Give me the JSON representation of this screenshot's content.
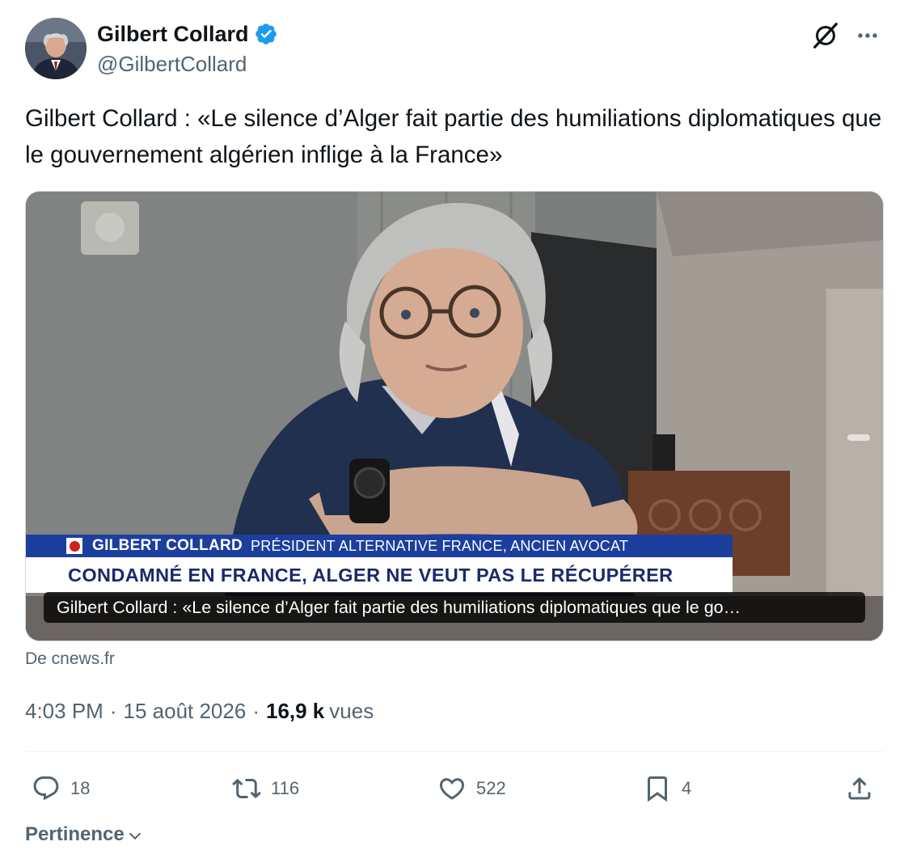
{
  "author": {
    "display_name": "Gilbert Collard",
    "handle": "@GilbertCollard",
    "verified": true,
    "verified_color": "#1d9bf0"
  },
  "header_icons": [
    "grok-icon",
    "more-icon"
  ],
  "tweet": {
    "text": "Gilbert Collard : «Le silence d’Alger fait partie des humiliations diplomatiques que le gouvernement algérien inflige à la France»"
  },
  "media": {
    "lower_third": {
      "name": "GILBERT COLLARD",
      "role": "PRÉSIDENT ALTERNATIVE FRANCE, ANCIEN AVOCAT",
      "headline": "CONDAMNÉ EN FRANCE, ALGER NE VEUT PAS LE RÉCUPÉRER",
      "bar_color": "#1c3f9e"
    },
    "caption": "Gilbert Collard : «Le silence d’Alger fait partie des humiliations diplomatiques que le go…"
  },
  "source": "De cnews.fr",
  "meta": {
    "time": "4:03 PM",
    "separator": "·",
    "date": "15 août 2026",
    "views_count": "16,9 k",
    "views_label": "vues"
  },
  "actions": {
    "reply": {
      "icon": "reply-icon",
      "count": "18"
    },
    "repost": {
      "icon": "repost-icon",
      "count": "116"
    },
    "like": {
      "icon": "heart-icon",
      "count": "522"
    },
    "bookmark": {
      "icon": "bookmark-icon",
      "count": "4"
    },
    "share": {
      "icon": "share-icon"
    }
  },
  "sort": {
    "label": "Pertinence",
    "icon": "chevron-down-icon"
  }
}
